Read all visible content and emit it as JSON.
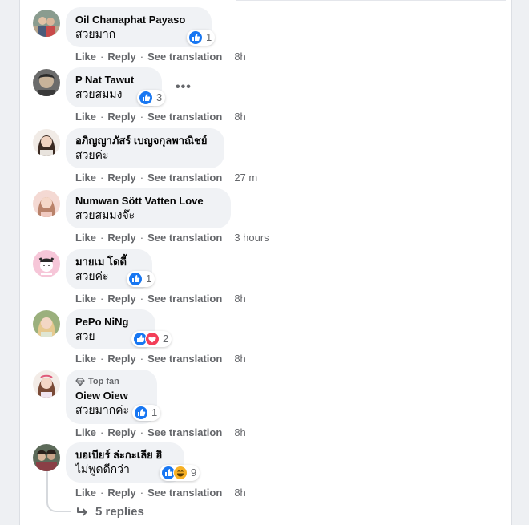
{
  "actions": {
    "like": "Like",
    "reply": "Reply",
    "see_translation": "See translation",
    "dot": "·"
  },
  "comments": [
    {
      "name": "Oil Chanaphat Payaso",
      "text": "สวยมาก",
      "reaction_count": "1",
      "reactions": [
        "like"
      ],
      "time": "8h"
    },
    {
      "name": "P Nat Tawut",
      "text": "สวยสมมง",
      "reaction_count": "3",
      "reactions": [
        "like"
      ],
      "time": "8h",
      "more_menu": "•••"
    },
    {
      "name": "อภิญญาภัสร์ เบญจกุลพาณิชย์",
      "text": "สวยค่ะ",
      "time": "27 m"
    },
    {
      "name": "Numwan Sött Vatten Love",
      "text": "สวยสมมงจ๊ะ",
      "time": "3 hours"
    },
    {
      "name": "มายเม โดตี้",
      "text": "สวยค่ะ",
      "reaction_count": "1",
      "reactions": [
        "like"
      ],
      "time": "8h"
    },
    {
      "name": "PePo NiNg",
      "text": "สวย",
      "reaction_count": "2",
      "reactions": [
        "like",
        "love"
      ],
      "time": "8h"
    },
    {
      "badge": "Top fan",
      "name": "Oiew Oiew",
      "text": "สวยมากค่ะ",
      "reaction_count": "1",
      "reactions": [
        "like"
      ],
      "time": "8h"
    },
    {
      "name": "บอเบียร์ ล่ะกะเลีย ฮิ",
      "text": "ไม่พูดดีกว่า",
      "reaction_count": "9",
      "reactions": [
        "like",
        "haha"
      ],
      "time": "8h"
    }
  ],
  "replies": {
    "label": "5 replies"
  },
  "colors": {
    "like_blue": "#1877f2",
    "love_red": "#f33e58",
    "haha_yellow": "#f7b125",
    "meta_gray": "#65676b",
    "bubble_gray": "#f0f2f5"
  }
}
